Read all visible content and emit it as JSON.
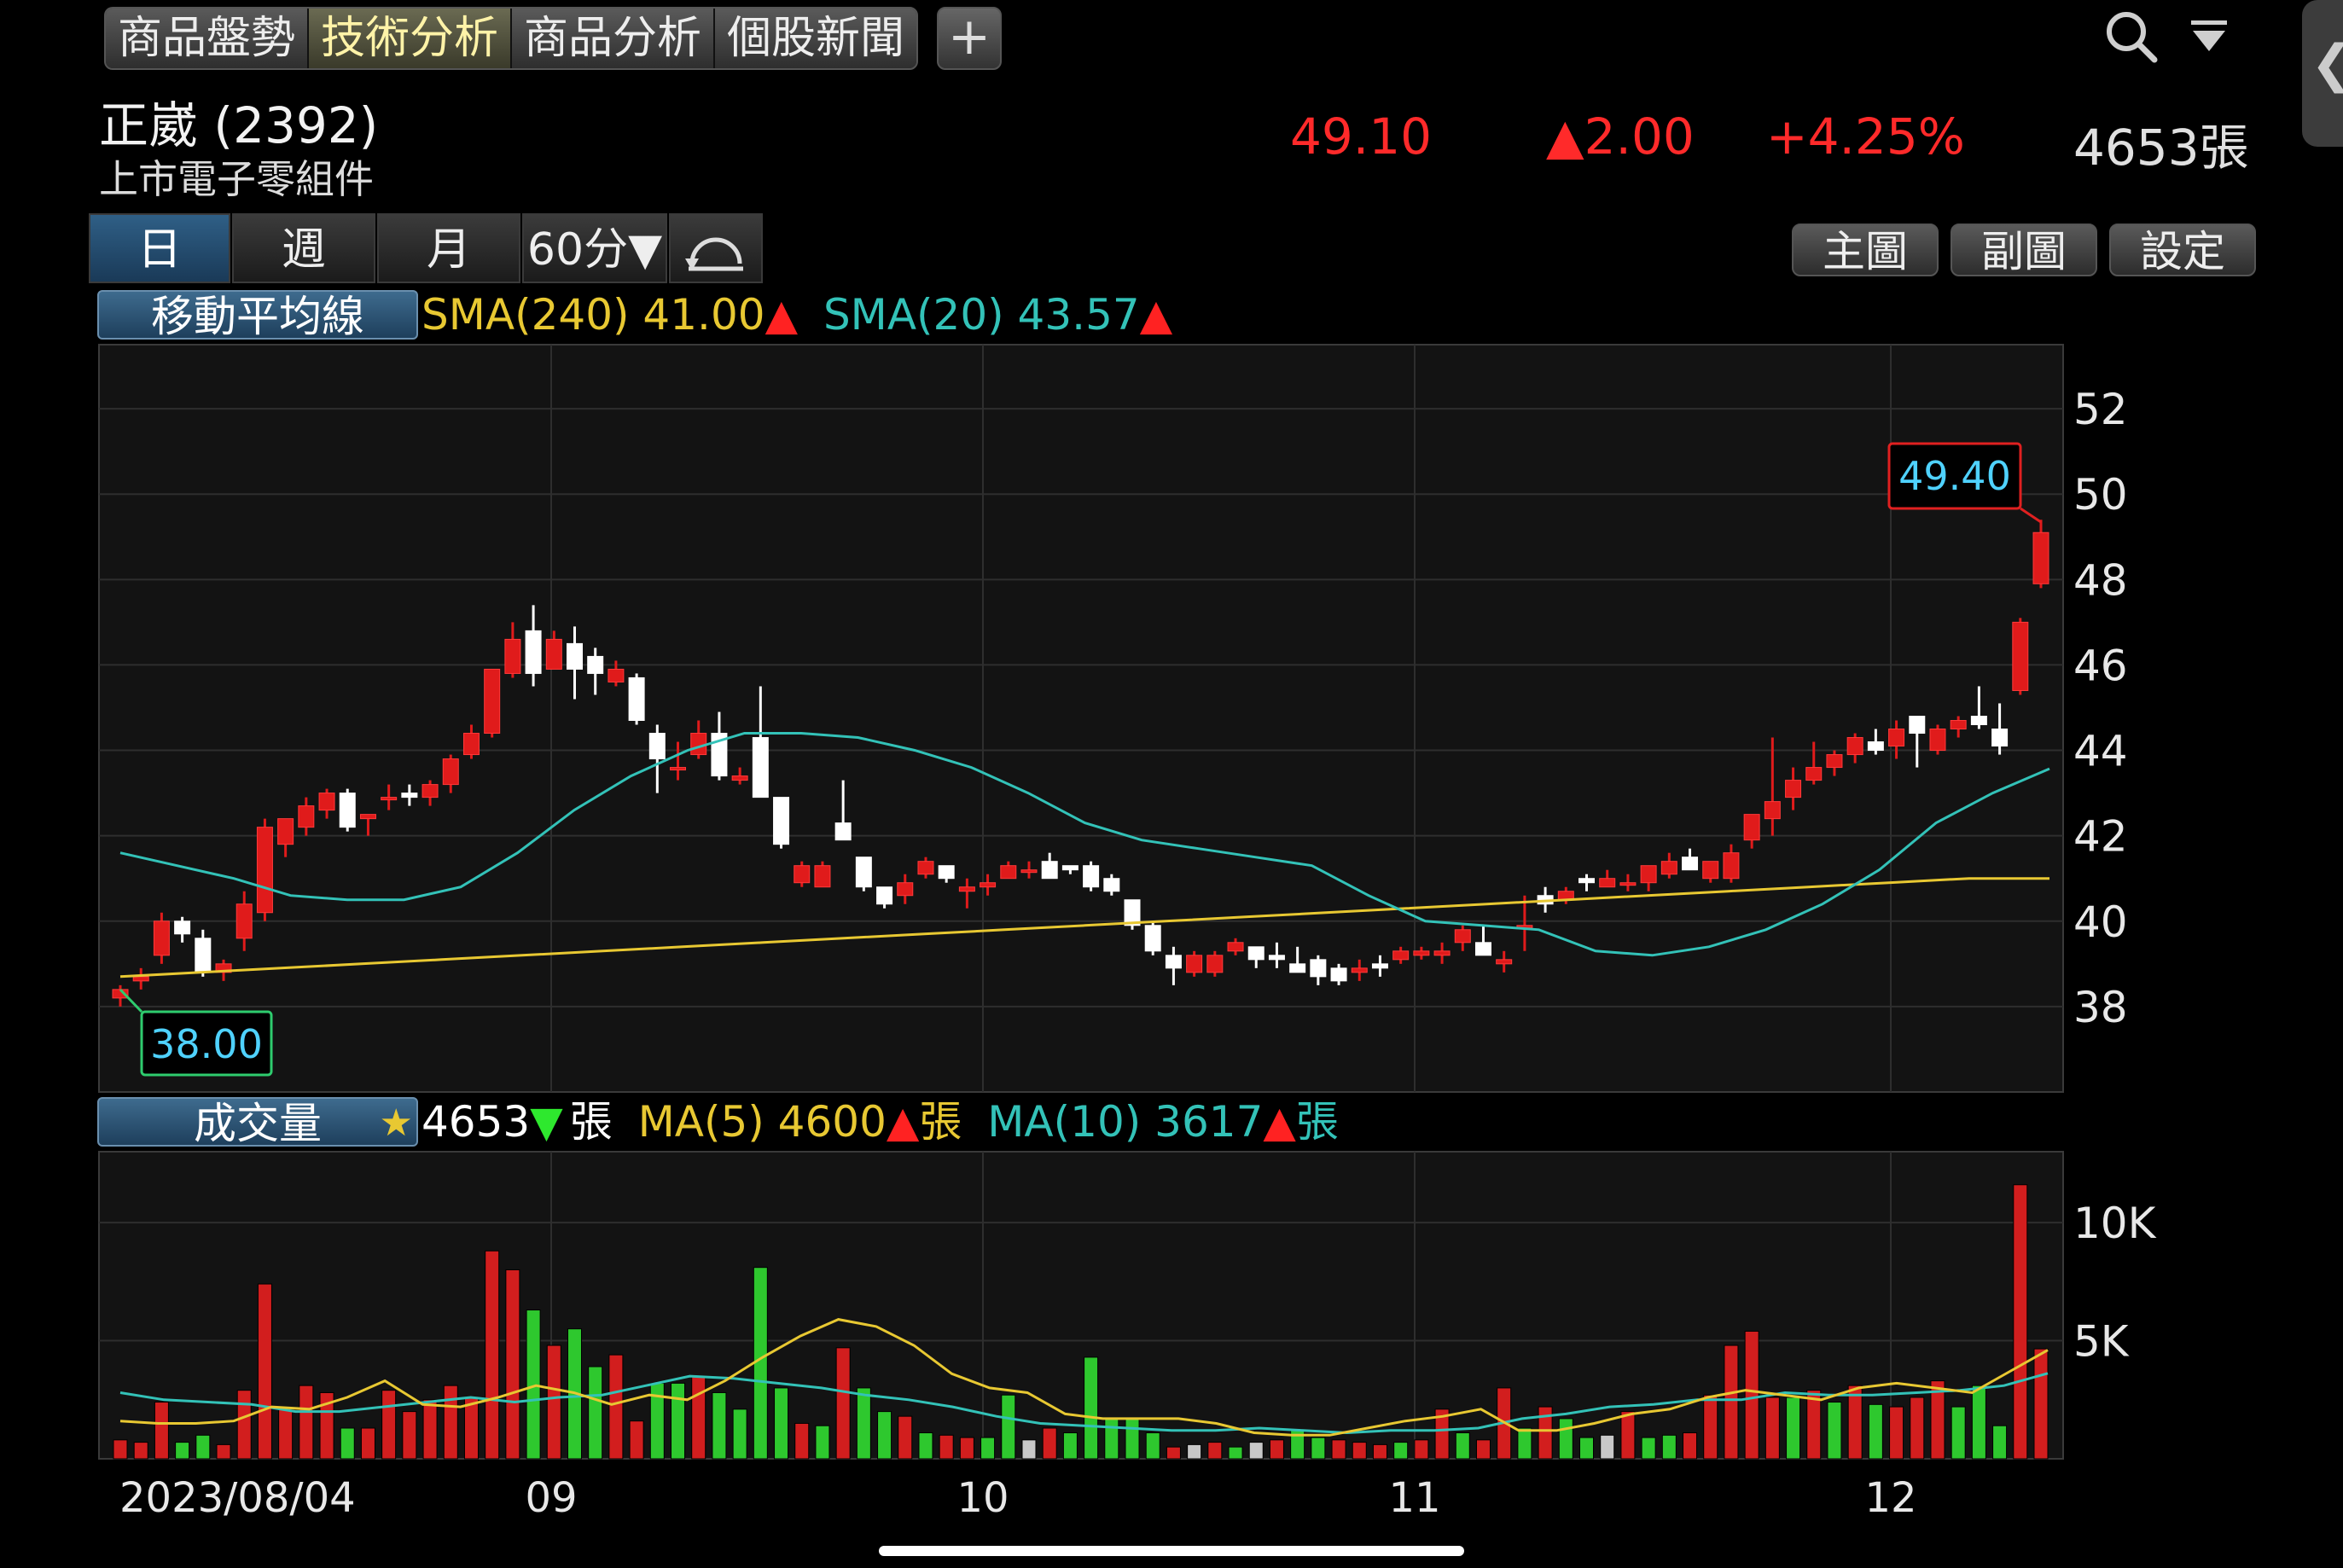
{
  "tabs": [
    "商品盤勢",
    "技術分析",
    "商品分析",
    "個股新聞"
  ],
  "add_tab": "+",
  "stock": {
    "name": "正崴 (2392)",
    "sector": "上市電子零組件",
    "price": "49.10",
    "change": "▲2.00",
    "change_pct": "+4.25%",
    "volume": "4653張"
  },
  "periods": [
    "日",
    "週",
    "月",
    "60分▼"
  ],
  "buttons": [
    "主圖",
    "副圖",
    "設定"
  ],
  "ma_indicator": {
    "label": "移動平均線",
    "sma240_text": "SMA(240) 41.00",
    "sma20_text": "SMA(20) 43.57",
    "arrow_up": "▲",
    "arrow_down": "▼"
  },
  "volume_indicator": {
    "label": "成交量",
    "star": "★",
    "vol_value": "4653",
    "unit": "張",
    "ma5_text": "MA(5) 4600",
    "ma10_text": "MA(10) 3617"
  },
  "colors": {
    "up": "#e01b1b",
    "down": "#ffffff",
    "vol_up": "#d21e1e",
    "vol_down": "#2ec82e",
    "vol_flat": "#c8c8c8",
    "sma240": "#e8c832",
    "sma20": "#33c2b8",
    "ma5": "#e8c832",
    "ma10": "#33c2b8",
    "grid": "#2e2e2e"
  },
  "chart_data": [
    {
      "type": "candlestick",
      "title": "",
      "x_labels": [
        "2023/08/04",
        "09",
        "10",
        "11",
        "12"
      ],
      "y_ticks": [
        38,
        40,
        42,
        44,
        46,
        48,
        50,
        52
      ],
      "ylim": [
        36,
        53.5
      ],
      "high_callout": "49.40",
      "low_callout": "38.00",
      "candles": [
        [
          38.2,
          38.5,
          38.0,
          38.4
        ],
        [
          38.6,
          38.9,
          38.4,
          38.7
        ],
        [
          39.2,
          40.2,
          39.0,
          40.0
        ],
        [
          40.0,
          40.1,
          39.5,
          39.7
        ],
        [
          39.6,
          39.8,
          38.7,
          38.8
        ],
        [
          38.8,
          39.1,
          38.6,
          39.0
        ],
        [
          39.6,
          40.7,
          39.3,
          40.4
        ],
        [
          40.2,
          42.4,
          40.0,
          42.2
        ],
        [
          41.8,
          42.4,
          41.5,
          42.4
        ],
        [
          42.2,
          42.9,
          42.0,
          42.7
        ],
        [
          42.6,
          43.1,
          42.4,
          43.0
        ],
        [
          43.0,
          43.1,
          42.1,
          42.2
        ],
        [
          42.4,
          42.5,
          42.0,
          42.5
        ],
        [
          42.9,
          43.2,
          42.6,
          42.9
        ],
        [
          43.0,
          43.2,
          42.7,
          42.9
        ],
        [
          42.9,
          43.3,
          42.7,
          43.2
        ],
        [
          43.2,
          43.9,
          43.0,
          43.8
        ],
        [
          43.9,
          44.6,
          43.8,
          44.4
        ],
        [
          44.4,
          45.9,
          44.3,
          45.9
        ],
        [
          45.8,
          47.0,
          45.7,
          46.6
        ],
        [
          46.8,
          47.4,
          45.5,
          45.8
        ],
        [
          45.9,
          46.8,
          45.9,
          46.6
        ],
        [
          46.5,
          46.9,
          45.2,
          45.9
        ],
        [
          46.2,
          46.4,
          45.3,
          45.8
        ],
        [
          45.6,
          46.1,
          45.5,
          45.9
        ],
        [
          45.7,
          45.8,
          44.6,
          44.7
        ],
        [
          44.4,
          44.6,
          43.0,
          43.8
        ],
        [
          43.6,
          44.2,
          43.3,
          43.6
        ],
        [
          43.9,
          44.7,
          43.8,
          44.4
        ],
        [
          44.4,
          44.9,
          43.3,
          43.4
        ],
        [
          43.3,
          43.6,
          43.2,
          43.4
        ],
        [
          44.3,
          45.5,
          42.9,
          42.9
        ],
        [
          42.9,
          42.9,
          41.7,
          41.8
        ],
        [
          40.9,
          41.4,
          40.8,
          41.3
        ],
        [
          40.8,
          41.4,
          40.8,
          41.3
        ],
        [
          42.3,
          43.3,
          41.9,
          41.9
        ],
        [
          41.5,
          41.5,
          40.7,
          40.8
        ],
        [
          40.8,
          40.8,
          40.3,
          40.4
        ],
        [
          40.6,
          41.1,
          40.4,
          40.9
        ],
        [
          41.1,
          41.5,
          41.0,
          41.4
        ],
        [
          41.3,
          41.3,
          40.9,
          41.0
        ],
        [
          40.7,
          41.0,
          40.3,
          40.8
        ],
        [
          40.8,
          41.1,
          40.6,
          40.9
        ],
        [
          41.0,
          41.4,
          41.0,
          41.3
        ],
        [
          41.2,
          41.4,
          41.0,
          41.2
        ],
        [
          41.4,
          41.6,
          41.0,
          41.0
        ],
        [
          41.3,
          41.3,
          41.1,
          41.2
        ],
        [
          41.3,
          41.4,
          40.7,
          40.8
        ],
        [
          41.0,
          41.1,
          40.6,
          40.7
        ],
        [
          40.5,
          40.5,
          39.8,
          39.9
        ],
        [
          39.9,
          40.0,
          39.2,
          39.3
        ],
        [
          39.2,
          39.4,
          38.5,
          38.9
        ],
        [
          38.8,
          39.3,
          38.7,
          39.2
        ],
        [
          38.8,
          39.3,
          38.7,
          39.2
        ],
        [
          39.3,
          39.6,
          39.2,
          39.5
        ],
        [
          39.4,
          39.4,
          38.9,
          39.1
        ],
        [
          39.2,
          39.5,
          38.9,
          39.1
        ],
        [
          39.0,
          39.4,
          38.8,
          38.8
        ],
        [
          39.1,
          39.2,
          38.5,
          38.7
        ],
        [
          38.9,
          39.0,
          38.5,
          38.6
        ],
        [
          38.8,
          39.1,
          38.6,
          38.9
        ],
        [
          39.0,
          39.2,
          38.7,
          38.9
        ],
        [
          39.1,
          39.4,
          39.0,
          39.3
        ],
        [
          39.2,
          39.4,
          39.1,
          39.3
        ],
        [
          39.2,
          39.5,
          39.0,
          39.3
        ],
        [
          39.5,
          39.9,
          39.3,
          39.8
        ],
        [
          39.5,
          39.9,
          39.2,
          39.2
        ],
        [
          39.0,
          39.3,
          38.8,
          39.1
        ],
        [
          39.9,
          40.6,
          39.3,
          39.9
        ],
        [
          40.6,
          40.8,
          40.2,
          40.4
        ],
        [
          40.5,
          40.8,
          40.4,
          40.7
        ],
        [
          41.0,
          41.1,
          40.7,
          40.9
        ],
        [
          40.8,
          41.2,
          40.8,
          41.0
        ],
        [
          40.9,
          41.1,
          40.7,
          40.9
        ],
        [
          40.9,
          41.3,
          40.7,
          41.3
        ],
        [
          41.1,
          41.6,
          41.0,
          41.4
        ],
        [
          41.5,
          41.7,
          41.3,
          41.2
        ],
        [
          41.0,
          41.4,
          40.9,
          41.4
        ],
        [
          41.0,
          41.8,
          40.9,
          41.6
        ],
        [
          41.9,
          42.2,
          41.7,
          42.5
        ],
        [
          42.4,
          44.3,
          42.0,
          42.8
        ],
        [
          42.9,
          43.6,
          42.6,
          43.3
        ],
        [
          43.3,
          44.2,
          43.2,
          43.6
        ],
        [
          43.6,
          44.0,
          43.4,
          43.9
        ],
        [
          43.9,
          44.4,
          43.7,
          44.3
        ],
        [
          44.2,
          44.5,
          43.9,
          44.0
        ],
        [
          44.1,
          44.7,
          43.8,
          44.5
        ],
        [
          44.8,
          44.8,
          43.6,
          44.4
        ],
        [
          44.0,
          44.6,
          43.9,
          44.5
        ],
        [
          44.5,
          44.8,
          44.3,
          44.7
        ],
        [
          44.8,
          45.5,
          44.5,
          44.6
        ],
        [
          44.5,
          45.1,
          43.9,
          44.1
        ],
        [
          45.4,
          47.1,
          45.3,
          47.0
        ],
        [
          47.9,
          49.4,
          47.8,
          49.1
        ]
      ],
      "sma240": [
        38.7,
        38.8,
        38.9,
        39.0,
        39.1,
        39.2,
        39.3,
        39.4,
        39.5,
        39.6,
        39.7,
        39.8,
        39.9,
        40.0,
        40.1,
        40.2,
        40.3,
        40.4,
        40.5,
        40.6,
        40.7,
        40.8,
        40.9,
        41.0,
        41.0
      ],
      "sma20": [
        41.6,
        41.3,
        41.0,
        40.6,
        40.5,
        40.5,
        40.8,
        41.6,
        42.6,
        43.4,
        44.0,
        44.4,
        44.4,
        44.3,
        44.0,
        43.6,
        43.0,
        42.3,
        41.9,
        41.7,
        41.5,
        41.3,
        40.6,
        40.0,
        39.9,
        39.8,
        39.3,
        39.2,
        39.4,
        39.8,
        40.4,
        41.2,
        42.3,
        43.0,
        43.57
      ]
    },
    {
      "type": "bar",
      "title": "成交量",
      "y_ticks": [
        "5K",
        "10K"
      ],
      "ylim": [
        0,
        13000
      ],
      "volumes": [
        [
          800,
          "u"
        ],
        [
          700,
          "u"
        ],
        [
          2400,
          "u"
        ],
        [
          700,
          "d"
        ],
        [
          1000,
          "d"
        ],
        [
          600,
          "u"
        ],
        [
          2900,
          "u"
        ],
        [
          7400,
          "u"
        ],
        [
          2100,
          "u"
        ],
        [
          3100,
          "u"
        ],
        [
          2800,
          "u"
        ],
        [
          1300,
          "d"
        ],
        [
          1300,
          "u"
        ],
        [
          2900,
          "u"
        ],
        [
          2000,
          "u"
        ],
        [
          2500,
          "u"
        ],
        [
          3100,
          "u"
        ],
        [
          2600,
          "u"
        ],
        [
          8800,
          "u"
        ],
        [
          8000,
          "u"
        ],
        [
          6300,
          "d"
        ],
        [
          4800,
          "u"
        ],
        [
          5500,
          "d"
        ],
        [
          3900,
          "d"
        ],
        [
          4400,
          "u"
        ],
        [
          1600,
          "u"
        ],
        [
          3200,
          "d"
        ],
        [
          3200,
          "d"
        ],
        [
          3500,
          "u"
        ],
        [
          2800,
          "d"
        ],
        [
          2100,
          "d"
        ],
        [
          8100,
          "d"
        ],
        [
          3000,
          "d"
        ],
        [
          1500,
          "u"
        ],
        [
          1400,
          "d"
        ],
        [
          4700,
          "u"
        ],
        [
          3000,
          "d"
        ],
        [
          2000,
          "d"
        ],
        [
          1800,
          "u"
        ],
        [
          1100,
          "d"
        ],
        [
          1000,
          "u"
        ],
        [
          900,
          "u"
        ],
        [
          900,
          "d"
        ],
        [
          2700,
          "d"
        ],
        [
          800,
          "flat"
        ],
        [
          1300,
          "u"
        ],
        [
          1100,
          "d"
        ],
        [
          4300,
          "d"
        ],
        [
          1700,
          "d"
        ],
        [
          1700,
          "d"
        ],
        [
          1100,
          "d"
        ],
        [
          500,
          "u"
        ],
        [
          600,
          "flat"
        ],
        [
          700,
          "u"
        ],
        [
          500,
          "d"
        ],
        [
          700,
          "flat"
        ],
        [
          800,
          "u"
        ],
        [
          1200,
          "d"
        ],
        [
          900,
          "d"
        ],
        [
          800,
          "u"
        ],
        [
          700,
          "u"
        ],
        [
          600,
          "u"
        ],
        [
          700,
          "d"
        ],
        [
          800,
          "u"
        ],
        [
          2100,
          "u"
        ],
        [
          1100,
          "d"
        ],
        [
          800,
          "u"
        ],
        [
          3000,
          "u"
        ],
        [
          1300,
          "d"
        ],
        [
          2200,
          "u"
        ],
        [
          1700,
          "d"
        ],
        [
          900,
          "d"
        ],
        [
          1000,
          "flat"
        ],
        [
          2000,
          "u"
        ],
        [
          900,
          "d"
        ],
        [
          1000,
          "d"
        ],
        [
          1100,
          "u"
        ],
        [
          2700,
          "u"
        ],
        [
          4800,
          "u"
        ],
        [
          5400,
          "u"
        ],
        [
          2600,
          "u"
        ],
        [
          2600,
          "d"
        ],
        [
          2900,
          "u"
        ],
        [
          2400,
          "d"
        ],
        [
          3100,
          "u"
        ],
        [
          2300,
          "d"
        ],
        [
          2200,
          "u"
        ],
        [
          2600,
          "u"
        ],
        [
          3300,
          "u"
        ],
        [
          2200,
          "d"
        ],
        [
          3100,
          "d"
        ],
        [
          1400,
          "d"
        ],
        [
          11600,
          "u"
        ],
        [
          4653,
          "u"
        ]
      ],
      "ma5": [
        1600,
        1500,
        1500,
        1600,
        2200,
        2100,
        2600,
        3300,
        2300,
        2200,
        2600,
        3100,
        2800,
        2300,
        2700,
        2500,
        3300,
        4300,
        5200,
        5900,
        5600,
        4800,
        3600,
        3000,
        2800,
        1900,
        1700,
        1700,
        1700,
        1500,
        1100,
        1000,
        1000,
        1300,
        1600,
        1800,
        2100,
        1200,
        1200,
        1500,
        1900,
        2100,
        2600,
        2900,
        2700,
        2500,
        3000,
        3200,
        3000,
        2800,
        3700,
        4600
      ],
      "ma10": [
        2800,
        2500,
        2400,
        2300,
        2000,
        2000,
        2200,
        2400,
        2600,
        2400,
        2600,
        2700,
        3100,
        3500,
        3400,
        3200,
        3000,
        2700,
        2500,
        2200,
        1800,
        1500,
        1400,
        1300,
        1200,
        1200,
        1300,
        1200,
        1100,
        1200,
        1200,
        1300,
        1700,
        1900,
        2200,
        2300,
        2500,
        2500,
        2800,
        2700,
        2700,
        2800,
        2900,
        3100,
        3617
      ]
    }
  ]
}
